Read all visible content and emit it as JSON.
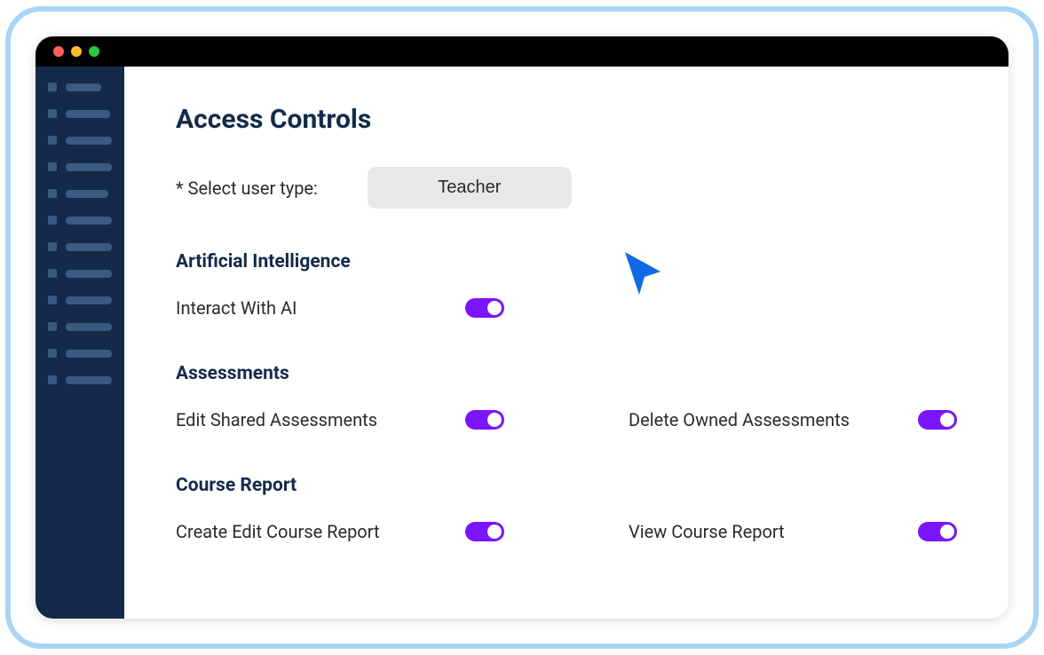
{
  "page": {
    "title": "Access Controls",
    "select_label": "* Select user type:",
    "user_type": "Teacher"
  },
  "sections": {
    "ai": {
      "title": "Artificial Intelligence",
      "interact_label": "Interact With AI"
    },
    "assessments": {
      "title": "Assessments",
      "edit_shared_label": "Edit Shared Assessments",
      "delete_owned_label": "Delete Owned Assessments"
    },
    "course_report": {
      "title": "Course Report",
      "create_edit_label": "Create Edit Course Report",
      "view_label": "View Course Report"
    }
  },
  "sidebar": {
    "item_count": 12
  },
  "colors": {
    "toggle_on": "#7b14ff",
    "sidebar_bg": "#132a4a",
    "frame_border": "#aad4f5"
  }
}
